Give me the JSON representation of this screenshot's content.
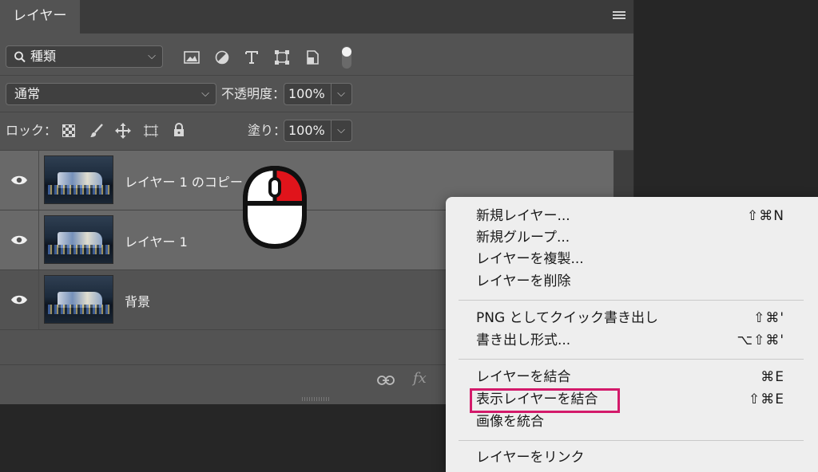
{
  "panel": {
    "tab_label": "レイヤー",
    "filter_label": "種類",
    "blend_mode": "通常",
    "opacity_label": "不透明度：",
    "opacity_value": "100%",
    "lock_label": "ロック：",
    "fill_label": "塗り：",
    "fill_value": "100%",
    "footer_fx": "fx"
  },
  "layers": [
    {
      "name": "レイヤー 1 のコピー"
    },
    {
      "name": "レイヤー 1"
    },
    {
      "name": "背景"
    }
  ],
  "menu": {
    "items": [
      {
        "label": "新規レイヤー...",
        "shortcut": "⇧⌘N"
      },
      {
        "label": "新規グループ...",
        "shortcut": ""
      },
      {
        "label": "レイヤーを複製...",
        "shortcut": ""
      },
      {
        "label": "レイヤーを削除",
        "shortcut": ""
      },
      {
        "label": "PNG としてクイック書き出し",
        "shortcut": "⇧⌘'"
      },
      {
        "label": "書き出し形式...",
        "shortcut": "⌥⇧⌘'"
      },
      {
        "label": "レイヤーを結合",
        "shortcut": "⌘E"
      },
      {
        "label": "表示レイヤーを結合",
        "shortcut": "⇧⌘E",
        "highlighted": true
      },
      {
        "label": "画像を統合",
        "shortcut": ""
      },
      {
        "label": "レイヤーをリンク",
        "shortcut": ""
      }
    ]
  },
  "colors": {
    "highlight_border": "#d31a6a",
    "mouse_button": "#e0141b"
  }
}
